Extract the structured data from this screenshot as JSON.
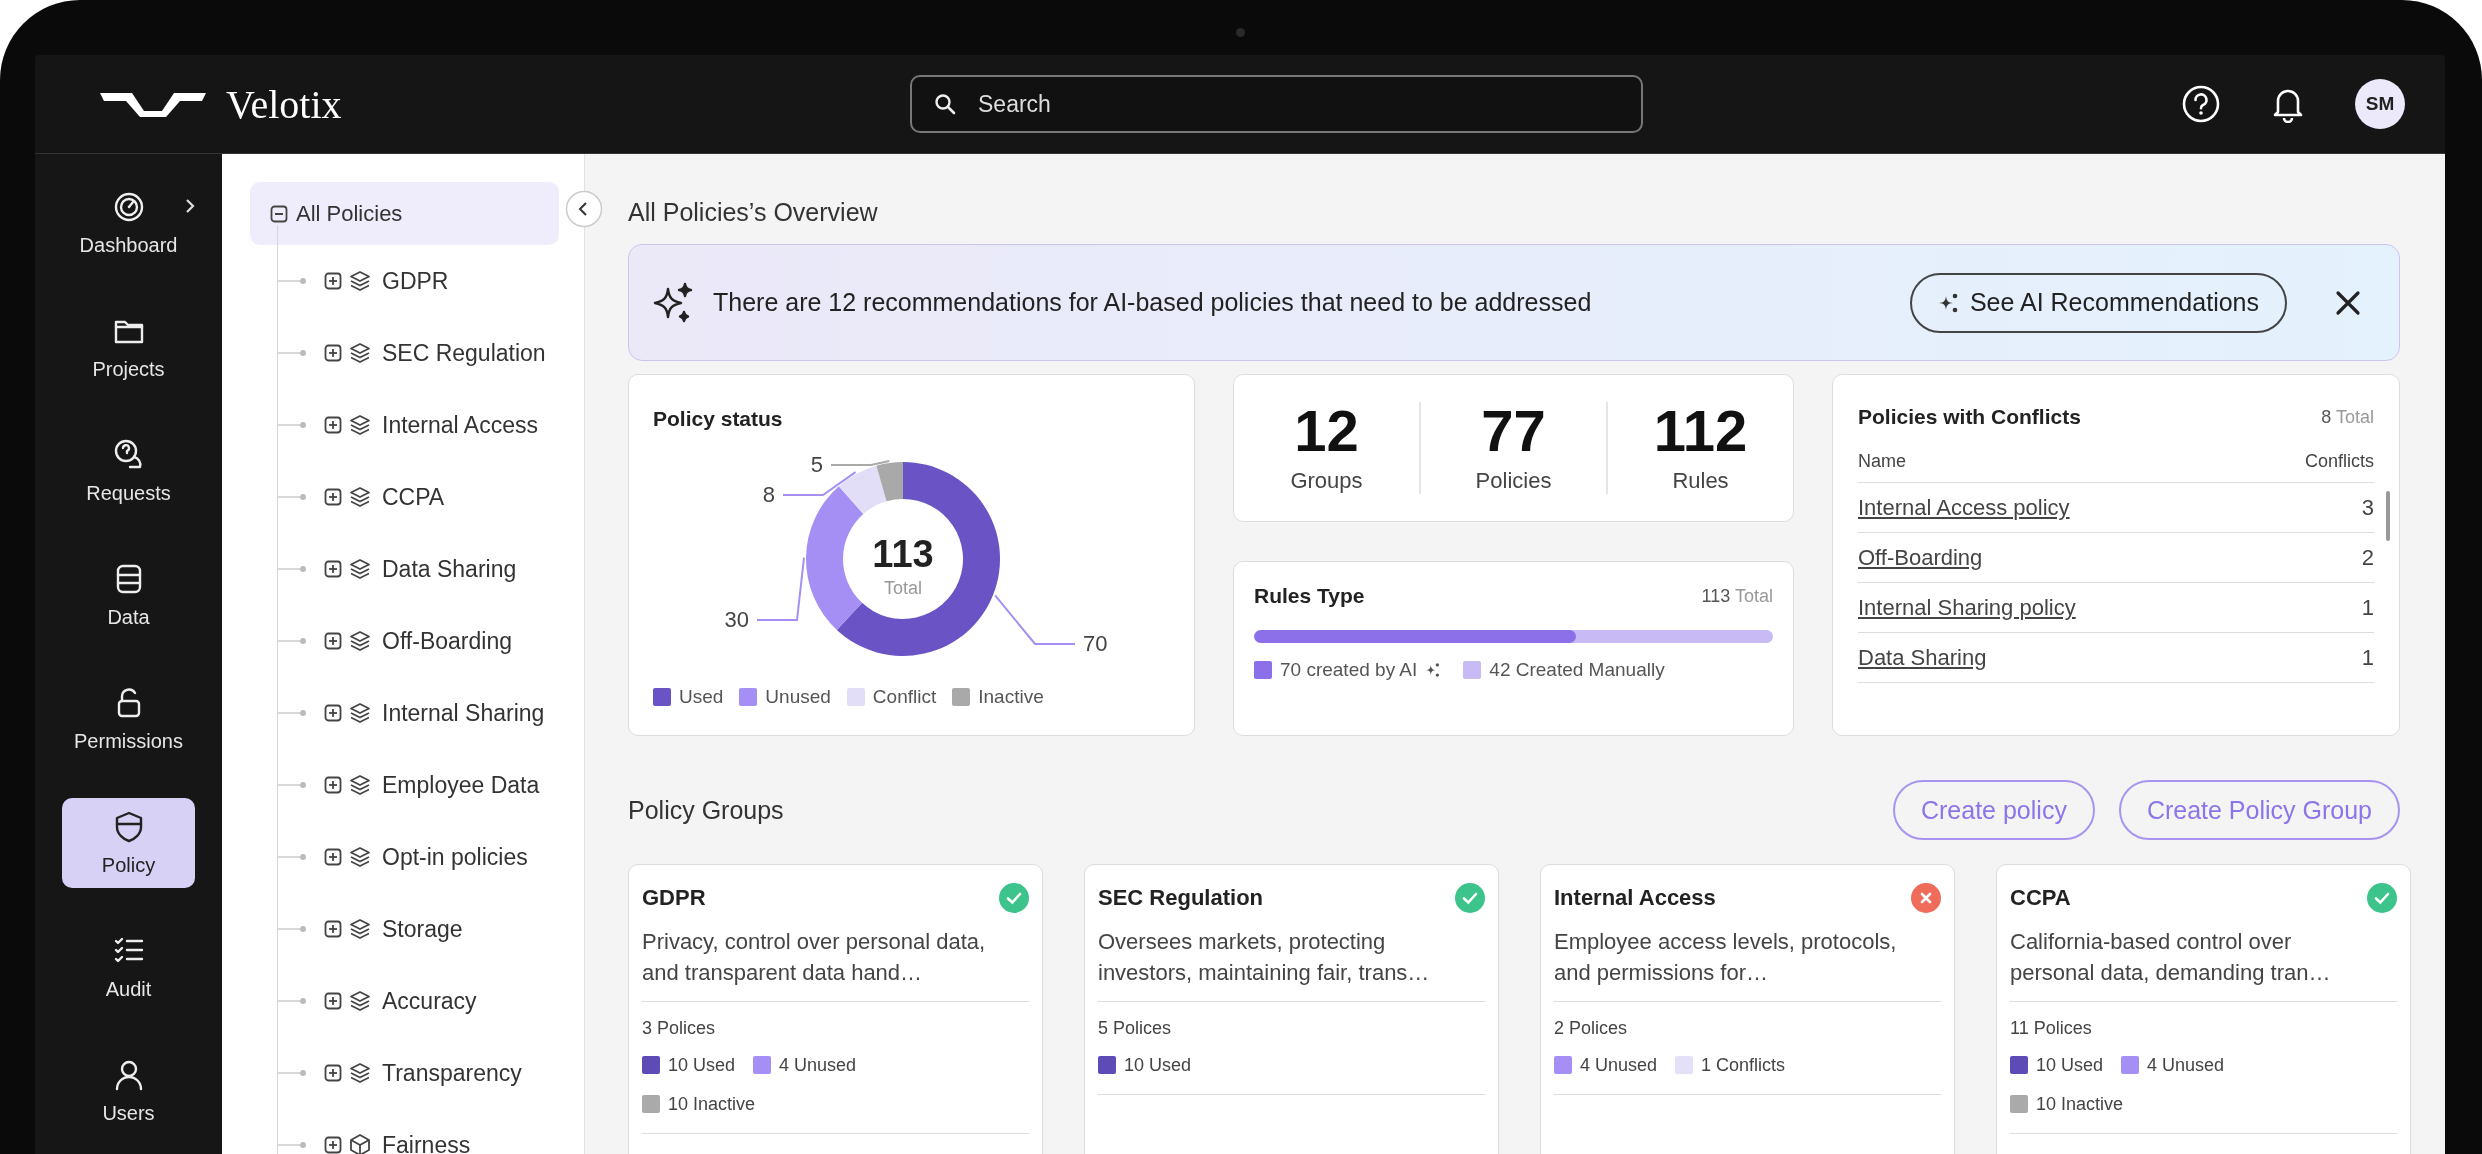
{
  "header": {
    "brand": "Velotix",
    "search": {
      "placeholder": "Search"
    },
    "avatar": "SM"
  },
  "nav": [
    {
      "label": "Dashboard",
      "selected": false
    },
    {
      "label": "Projects",
      "selected": false
    },
    {
      "label": "Requests",
      "selected": false
    },
    {
      "label": "Data",
      "selected": false
    },
    {
      "label": "Permissions",
      "selected": false
    },
    {
      "label": "Policy",
      "selected": true
    },
    {
      "label": "Audit",
      "selected": false
    },
    {
      "label": "Users",
      "selected": false
    }
  ],
  "tree": {
    "label": "All Policies",
    "expanded": true,
    "selected": true,
    "children": [
      {
        "label": "GDPR",
        "kind": "stack",
        "expanded": false
      },
      {
        "label": "SEC Regulation",
        "kind": "stack",
        "expanded": false
      },
      {
        "label": "Internal Access",
        "kind": "stack",
        "expanded": false
      },
      {
        "label": "CCPA",
        "kind": "stack",
        "expanded": false
      },
      {
        "label": "Data Sharing",
        "kind": "stack",
        "expanded": false
      },
      {
        "label": "Off-Boarding",
        "kind": "stack",
        "expanded": false
      },
      {
        "label": "Internal Sharing",
        "kind": "stack",
        "expanded": false
      },
      {
        "label": "Employee Data",
        "kind": "stack",
        "expanded": false
      },
      {
        "label": "Opt-in policies",
        "kind": "stack",
        "expanded": false
      },
      {
        "label": "Storage",
        "kind": "stack",
        "expanded": false
      },
      {
        "label": "Accuracy",
        "kind": "stack",
        "expanded": false
      },
      {
        "label": "Transparency",
        "kind": "stack",
        "expanded": false
      },
      {
        "label": "Fairness",
        "kind": "cube",
        "expanded": false
      }
    ]
  },
  "overview": {
    "title": "All Policies’s Overview",
    "banner": {
      "text": "There are 12 recommendations for AI-based policies that need to be addressed",
      "button": "See AI Recommendations"
    },
    "policy_status": {
      "title": "Policy status",
      "total": "113",
      "total_label": "Total",
      "chart_data": {
        "type": "donut",
        "categories": [
          "Used",
          "Unused",
          "Conflict",
          "Inactive"
        ],
        "values": [
          70,
          30,
          8,
          5
        ],
        "colors": [
          "#6a53c4",
          "#a68ff4",
          "#e2def7",
          "#a9a9a9"
        ],
        "data_labels": true
      }
    },
    "stats": [
      {
        "value": "12",
        "label": "Groups"
      },
      {
        "value": "77",
        "label": "Policies"
      },
      {
        "value": "112",
        "label": "Rules"
      }
    ],
    "rules_type": {
      "title": "Rules Type",
      "total": "113",
      "total_label": "Total",
      "level": 0.62,
      "legend": [
        {
          "label": "70 created by AI",
          "color": "#8b70ea",
          "kind": "ai"
        },
        {
          "label": "42 Created Manually",
          "color": "#c7baf5",
          "kind": "plain"
        }
      ]
    },
    "conflicts": {
      "title": "Policies with Conflicts",
      "total": "8",
      "total_label": "Total",
      "columns": [
        "Name",
        "Conflicts"
      ],
      "rows": [
        {
          "name": "Internal Access policy",
          "count": "3"
        },
        {
          "name": "Off-Boarding",
          "count": "2"
        },
        {
          "name": "Internal Sharing policy",
          "count": "1"
        },
        {
          "name": "Data Sharing",
          "count": "1"
        }
      ]
    }
  },
  "groups": {
    "title": "Policy Groups",
    "buttons": [
      "Create policy",
      "Create Policy Group"
    ],
    "cards": [
      {
        "title": "GDPR",
        "has_error": false,
        "description": "Privacy, control over personal data, and transparent data hand…",
        "count": "3 Polices",
        "tags": [
          {
            "label": "10 Used",
            "color": "#5f4bb6"
          },
          {
            "label": "4 Unused",
            "color": "#a68ff4"
          },
          {
            "label": "10 Inactive",
            "color": "#aaaaaa"
          }
        ]
      },
      {
        "title": "SEC Regulation",
        "has_error": false,
        "description": "Oversees markets, protecting investors, maintaining fair, trans…",
        "count": "5 Polices",
        "tags": [
          {
            "label": "10 Used",
            "color": "#5f4bb6"
          }
        ]
      },
      {
        "title": "Internal Access",
        "has_error": true,
        "description": "Employee access levels, protocols, and permissions for…",
        "count": "2 Polices",
        "tags": [
          {
            "label": "4 Unused",
            "color": "#a68ff4"
          },
          {
            "label": "1 Conflicts",
            "color": "#e4e0f7"
          }
        ]
      },
      {
        "title": "CCPA",
        "has_error": false,
        "description": "California-based control over personal data, demanding tran…",
        "count": "11 Polices",
        "tags": [
          {
            "label": "10 Used",
            "color": "#5f4bb6"
          },
          {
            "label": "4 Unused",
            "color": "#a68ff4"
          },
          {
            "label": "10 Inactive",
            "color": "#aaaaaa"
          }
        ]
      }
    ]
  }
}
